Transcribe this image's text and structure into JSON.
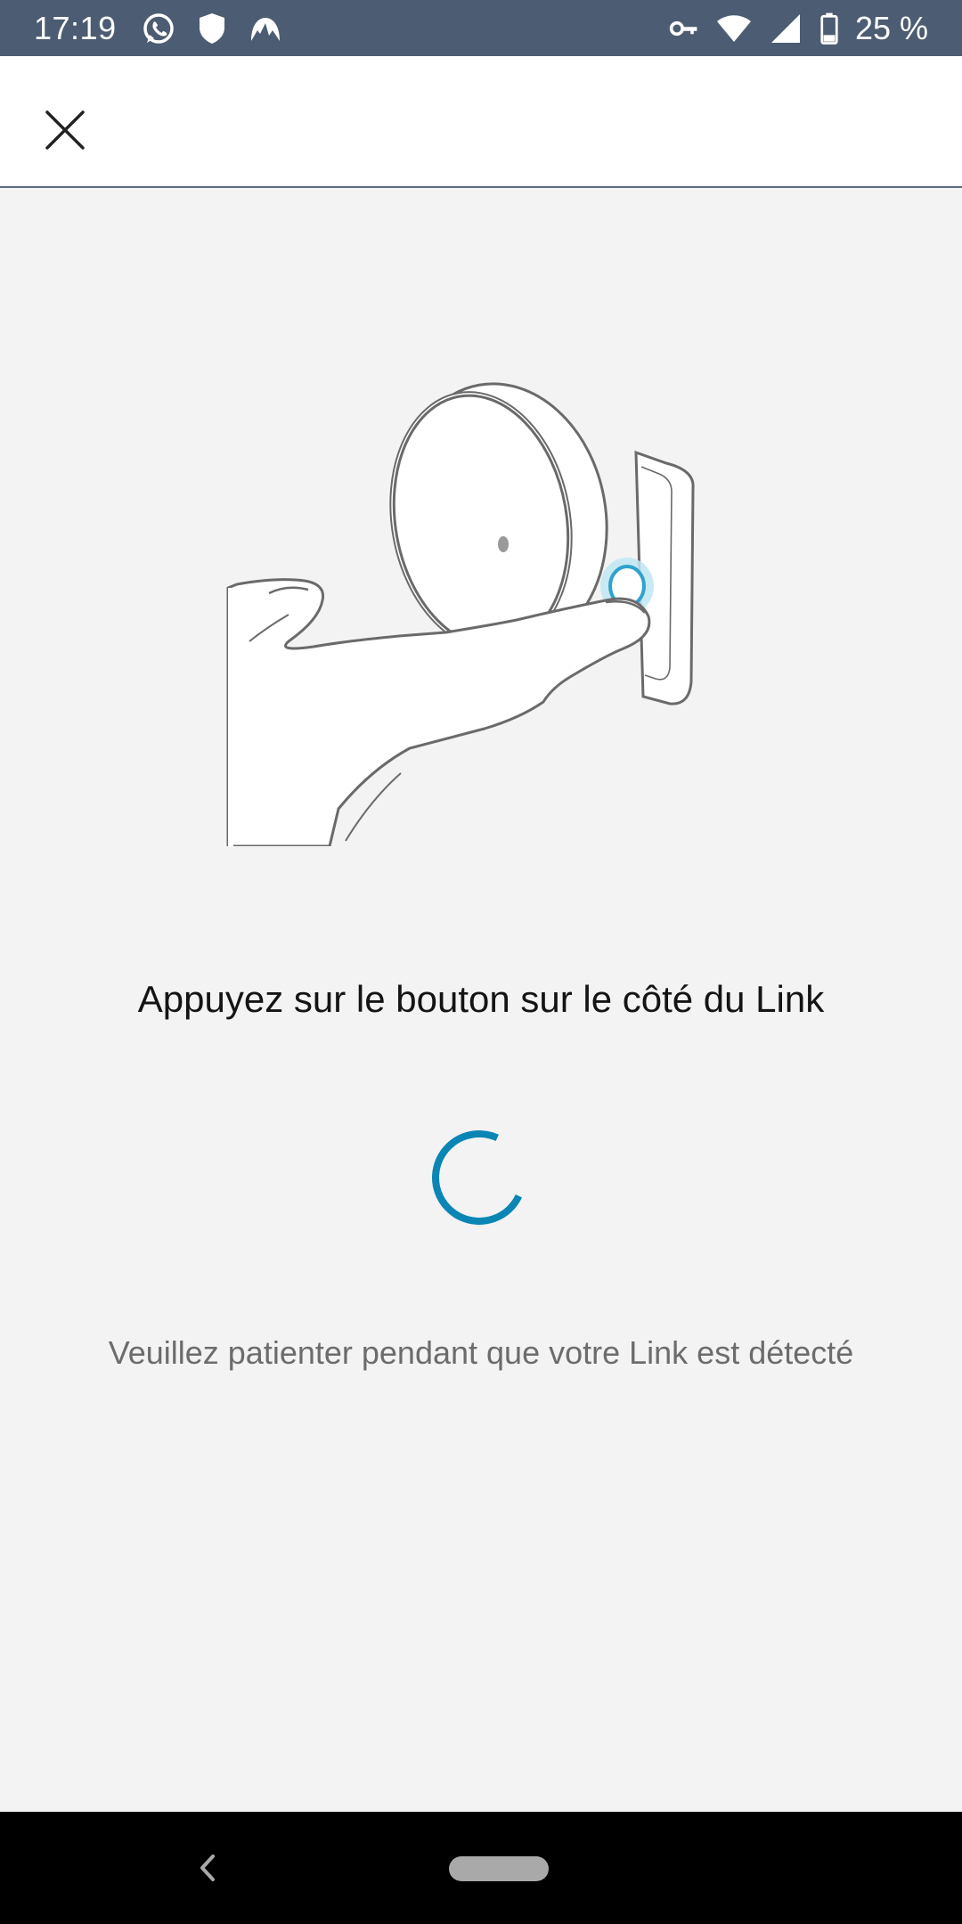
{
  "status_bar": {
    "time": "17:19",
    "left_icons": [
      "whatsapp-icon",
      "shield-icon",
      "nordvpn-icon"
    ],
    "right_icons": [
      "vpn-key-icon",
      "wifi-icon",
      "signal-icon",
      "battery-icon"
    ],
    "battery_text": "25 %"
  },
  "app_bar": {
    "close_icon": "close-icon"
  },
  "main": {
    "illustration": "hand-pressing-link-button",
    "instruction": "Appuyez sur le bouton sur le côté du Link",
    "wait_message": "Veuillez patienter pendant que votre Link est détecté"
  },
  "colors": {
    "status_bar": "#4c5c72",
    "background": "#f3f3f3",
    "accent": "#0a86b5",
    "text_primary": "#141414",
    "text_secondary": "#6c6c6c"
  },
  "nav_bar": {
    "icons": [
      "back-icon",
      "home-pill"
    ]
  }
}
